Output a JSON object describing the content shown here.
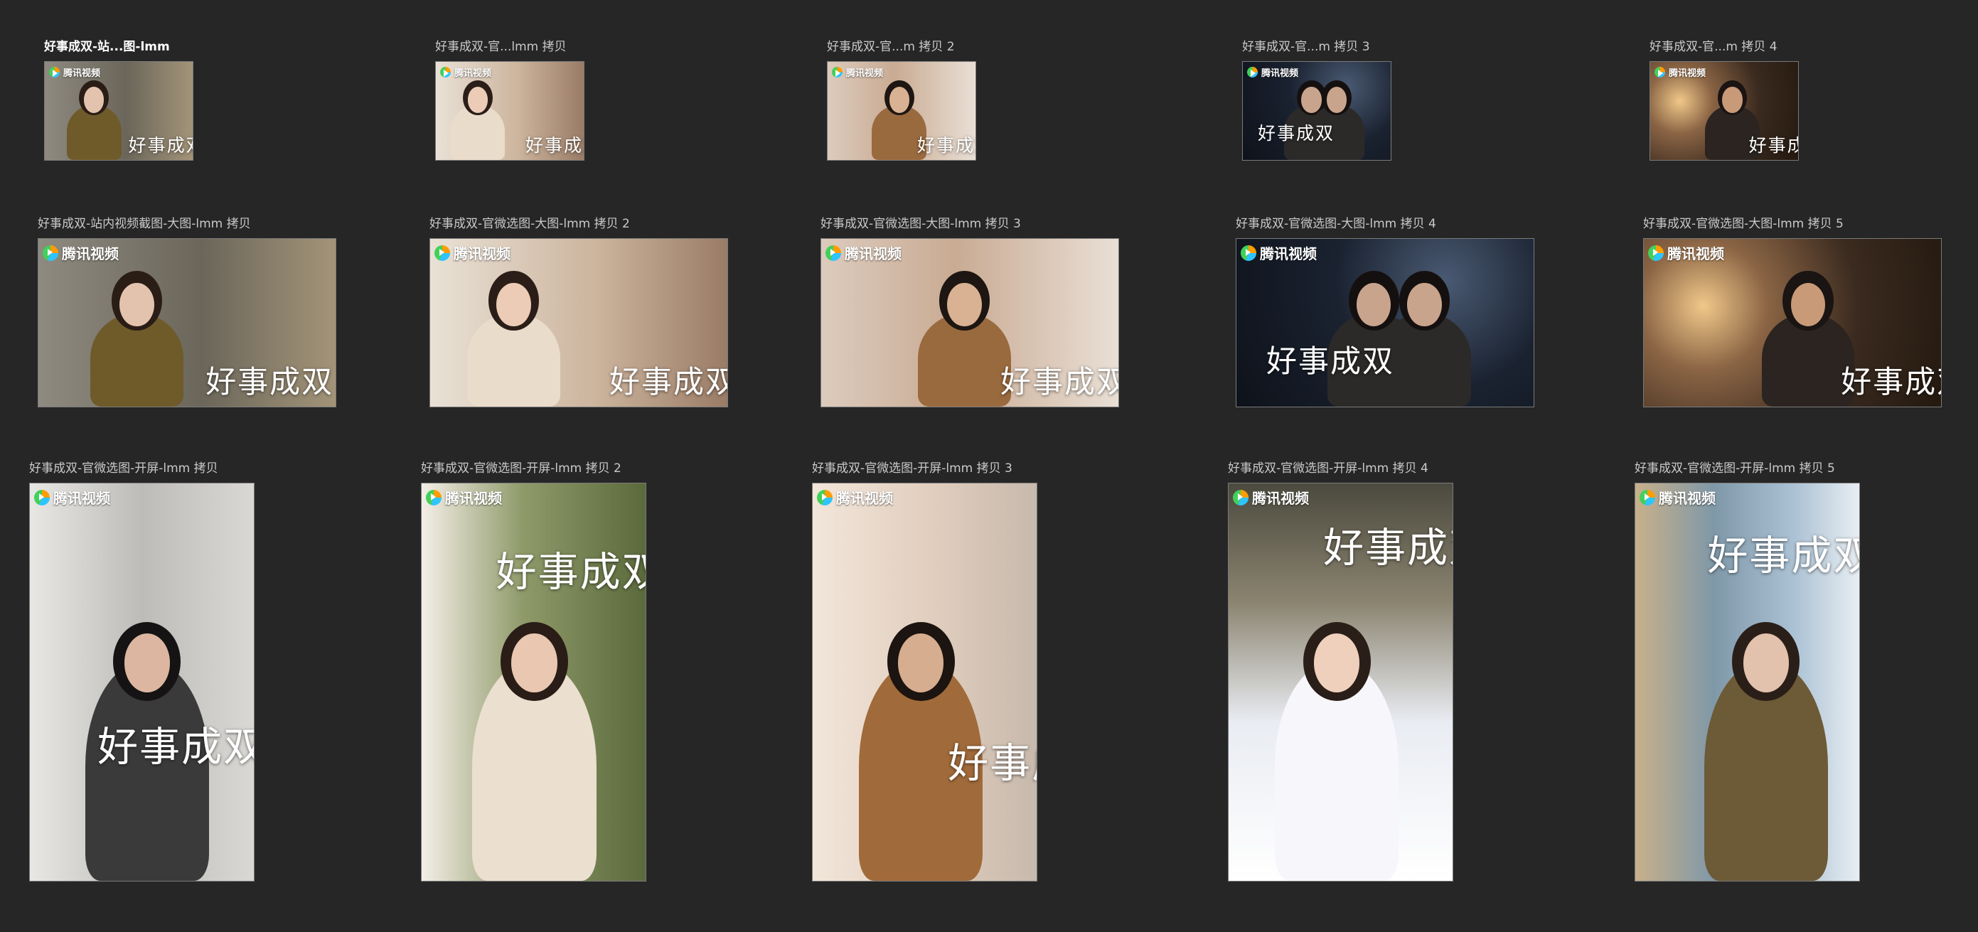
{
  "logo_text": "腾讯视频",
  "title_mark": "好事成双",
  "artboards": [
    {
      "label": "好事成双-站...图-lmm",
      "selected": true,
      "scene": "woman-olive",
      "bg": "#6e6656"
    },
    {
      "label": "好事成双-官...lmm 拷贝",
      "selected": false,
      "scene": "woman-cream",
      "bg": "#c9b8a4"
    },
    {
      "label": "好事成双-官...m 拷贝 2",
      "selected": false,
      "scene": "man-camel",
      "bg": "#cdb7a3"
    },
    {
      "label": "好事成双-官...m 拷贝 3",
      "selected": false,
      "scene": "night-couple",
      "bg": "#1e2530"
    },
    {
      "label": "好事成双-官...m 拷贝 4",
      "selected": false,
      "scene": "lamp-desk",
      "bg": "#3a2c22"
    },
    {
      "label": "好事成双-站内视频截图-大图-lmm 拷贝",
      "selected": false,
      "scene": "woman-olive",
      "bg": "#6e6656"
    },
    {
      "label": "好事成双-官微选图-大图-lmm 拷贝 2",
      "selected": false,
      "scene": "woman-cream",
      "bg": "#c9b8a4"
    },
    {
      "label": "好事成双-官微选图-大图-lmm 拷贝 3",
      "selected": false,
      "scene": "man-camel",
      "bg": "#cdb7a3"
    },
    {
      "label": "好事成双-官微选图-大图-lmm 拷贝 4",
      "selected": false,
      "scene": "night-couple",
      "bg": "#1e2530"
    },
    {
      "label": "好事成双-官微选图-大图-lmm 拷贝 5",
      "selected": false,
      "scene": "lamp-desk",
      "bg": "#3a2c22"
    },
    {
      "label": "好事成双-官微选图-开屏-lmm 拷贝",
      "selected": false,
      "scene": "man-grey-coat",
      "bg": "#c4c3c0"
    },
    {
      "label": "好事成双-官微选图-开屏-lmm 拷贝 2",
      "selected": false,
      "scene": "woman-sofa",
      "bg": "#9ba07e"
    },
    {
      "label": "好事成双-官微选图-开屏-lmm 拷贝 3",
      "selected": false,
      "scene": "man-profile",
      "bg": "#e4d6c8"
    },
    {
      "label": "好事成双-官微选图-开屏-lmm 拷贝 4",
      "selected": false,
      "scene": "bride",
      "bg": "#5d5a4d"
    },
    {
      "label": "好事成双-官微选图-开屏-lmm 拷贝 5",
      "selected": false,
      "scene": "woman-profile",
      "bg": "#8fa3b5"
    }
  ]
}
